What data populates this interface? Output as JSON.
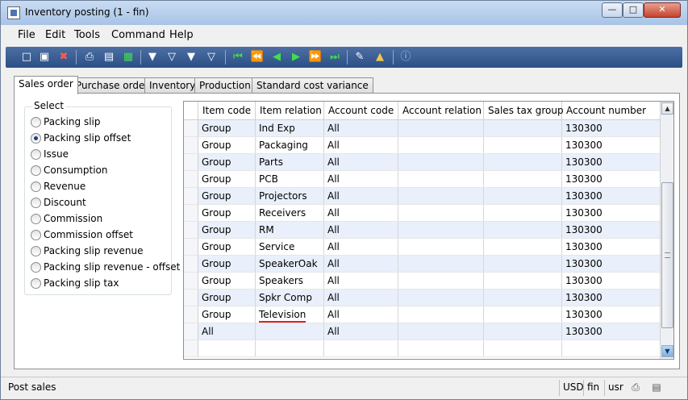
{
  "window": {
    "title": "Inventory posting (1 - fin)"
  },
  "menu": [
    "File",
    "Edit",
    "Tools",
    "Command",
    "Help"
  ],
  "toolbar_icons": [
    "new-icon",
    "save-icon",
    "delete-icon",
    "print-icon",
    "print-preview-icon",
    "excel-icon",
    "filter-by-selection-icon",
    "filter-by-grid-icon",
    "advanced-filter-icon",
    "remove-filter-icon",
    "first-record-icon",
    "previous-page-icon",
    "previous-record-icon",
    "next-record-icon",
    "next-page-icon",
    "last-record-icon",
    "document-handling-icon",
    "alert-icon",
    "help-icon"
  ],
  "tabs": [
    "Sales order",
    "Purchase order",
    "Inventory",
    "Production",
    "Standard cost variance"
  ],
  "select": {
    "title": "Select",
    "options": [
      "Packing slip",
      "Packing slip offset",
      "Issue",
      "Consumption",
      "Revenue",
      "Discount",
      "Commission",
      "Commission offset",
      "Packing slip revenue",
      "Packing slip revenue - offset",
      "Packing slip tax"
    ],
    "selected": "Packing slip offset"
  },
  "grid": {
    "columns": [
      "Item code",
      "Item relation",
      "Account code",
      "Account relation",
      "Sales tax group",
      "Account number"
    ],
    "rows": [
      [
        "Group",
        "Ind Exp",
        "All",
        "",
        "",
        "130300"
      ],
      [
        "Group",
        "Packaging",
        "All",
        "",
        "",
        "130300"
      ],
      [
        "Group",
        "Parts",
        "All",
        "",
        "",
        "130300"
      ],
      [
        "Group",
        "PCB",
        "All",
        "",
        "",
        "130300"
      ],
      [
        "Group",
        "Projectors",
        "All",
        "",
        "",
        "130300"
      ],
      [
        "Group",
        "Receivers",
        "All",
        "",
        "",
        "130300"
      ],
      [
        "Group",
        "RM",
        "All",
        "",
        "",
        "130300"
      ],
      [
        "Group",
        "Service",
        "All",
        "",
        "",
        "130300"
      ],
      [
        "Group",
        "SpeakerOak",
        "All",
        "",
        "",
        "130300"
      ],
      [
        "Group",
        "Speakers",
        "All",
        "",
        "",
        "130300"
      ],
      [
        "Group",
        "Spkr Comp",
        "All",
        "",
        "",
        "130300"
      ],
      [
        "Group",
        "Television",
        "All",
        "",
        "",
        "130300"
      ],
      [
        "All",
        "",
        "All",
        "",
        "",
        "130300"
      ],
      [
        "",
        "",
        "",
        "",
        "",
        ""
      ]
    ]
  },
  "status": {
    "text": "Post sales",
    "currency": "USD",
    "company": "fin",
    "layer": "usr"
  }
}
